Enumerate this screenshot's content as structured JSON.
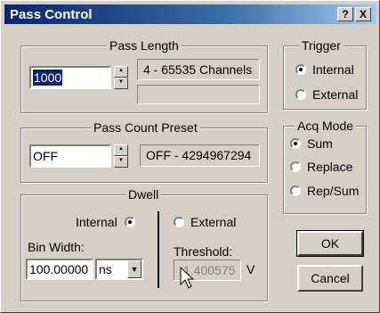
{
  "window": {
    "title": "Pass Control",
    "help_label": "?",
    "close_label": "X"
  },
  "pass_length": {
    "title": "Pass Length",
    "value": "1000",
    "range_text": "4 - 65535 Channels",
    "info_text": ""
  },
  "pass_count": {
    "title": "Pass Count Preset",
    "value": "OFF",
    "range_text": "OFF - 4294967294"
  },
  "dwell": {
    "title": "Dwell",
    "internal_label": "Internal",
    "external_label": "External",
    "selected": "Internal",
    "bin_width_label": "Bin Width:",
    "bin_width_value": "100.00000",
    "unit_value": "ns",
    "threshold_label": "Threshold:",
    "threshold_value": "1.400575",
    "threshold_unit": "V"
  },
  "trigger": {
    "title": "Trigger",
    "options": [
      "Internal",
      "External"
    ],
    "selected": "Internal"
  },
  "acq_mode": {
    "title": "Acq Mode",
    "options": [
      "Sum",
      "Replace",
      "Rep/Sum"
    ],
    "selected": "Sum"
  },
  "buttons": {
    "ok": "OK",
    "cancel": "Cancel"
  }
}
